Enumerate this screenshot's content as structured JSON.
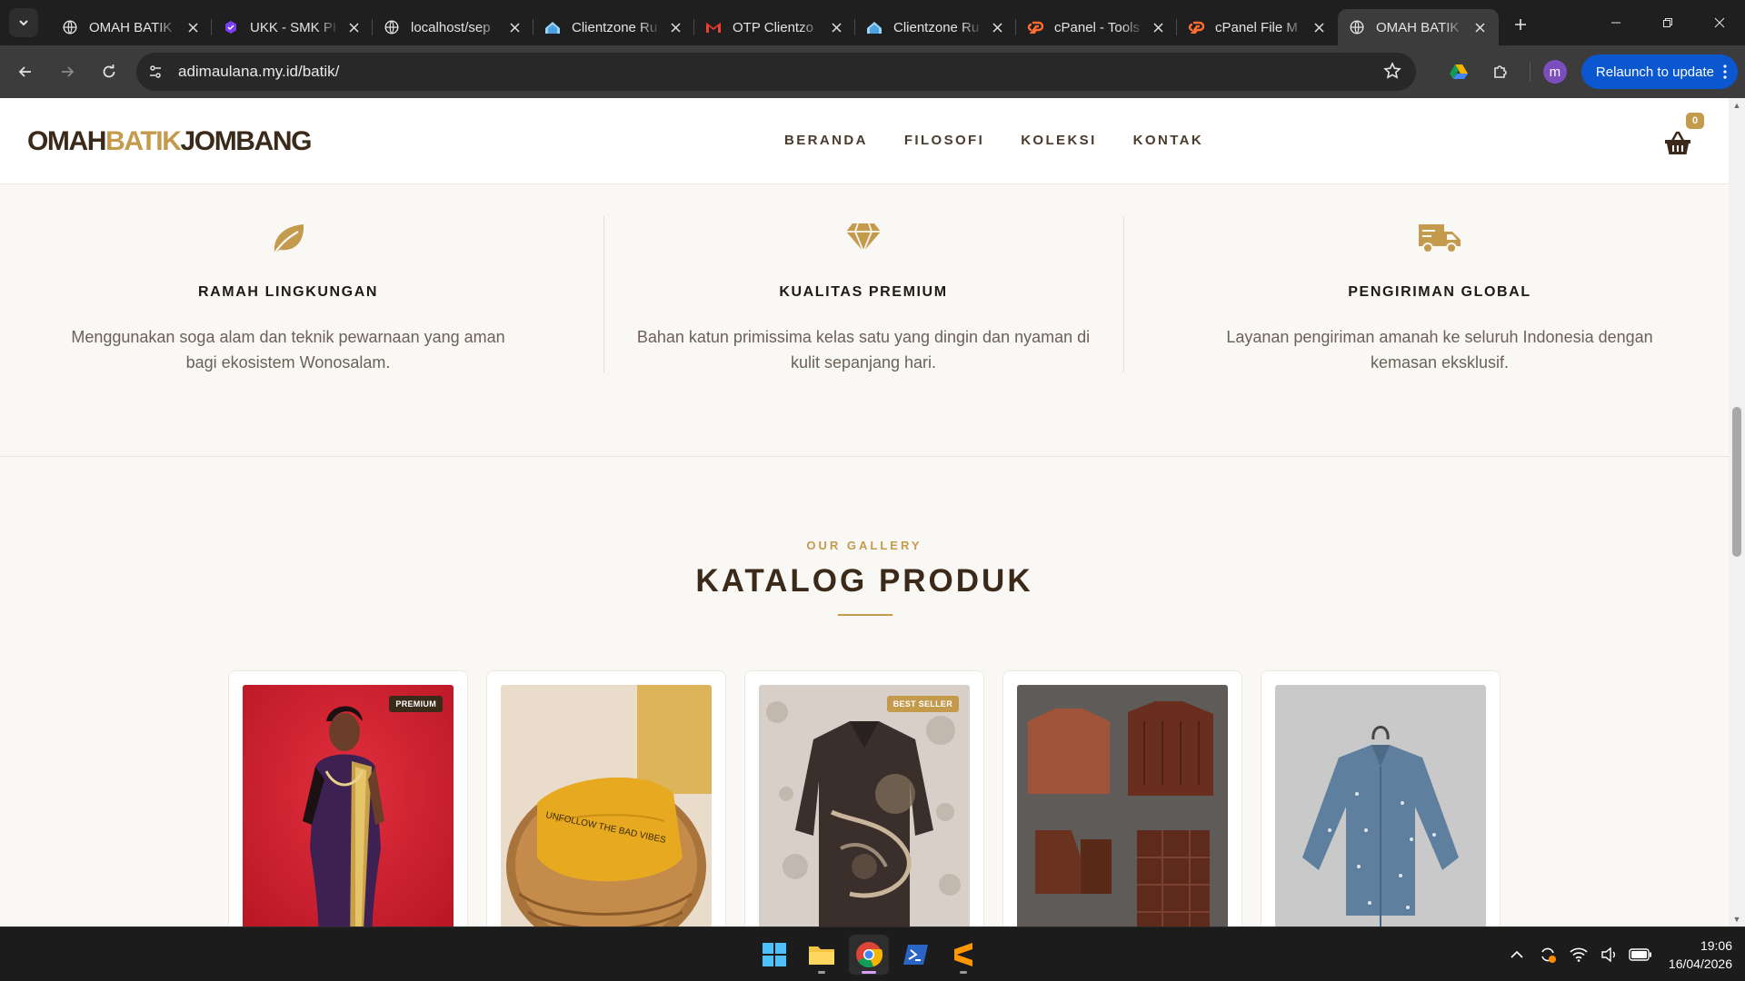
{
  "browser": {
    "tabs": [
      {
        "title": "OMAH BATIK",
        "icon": "globe-icon",
        "active": false
      },
      {
        "title": "UKK - SMK PI",
        "icon": "hexagon-icon",
        "active": false
      },
      {
        "title": "localhost/sep",
        "icon": "globe-icon",
        "active": false
      },
      {
        "title": "Clientzone Ru",
        "icon": "clientzone-icon",
        "active": false
      },
      {
        "title": "OTP Clientzo",
        "icon": "gmail-icon",
        "active": false
      },
      {
        "title": "Clientzone Ru",
        "icon": "clientzone-icon",
        "active": false
      },
      {
        "title": "cPanel - Tools",
        "icon": "cpanel-icon",
        "active": false
      },
      {
        "title": "cPanel File M",
        "icon": "cpanel-icon",
        "active": false
      },
      {
        "title": "OMAH BATIK",
        "icon": "globe-icon",
        "active": true
      }
    ],
    "url": "adimaulana.my.id/batik/",
    "profile_initial": "m",
    "relaunch_label": "Relaunch to update"
  },
  "site": {
    "logo": {
      "part1": "OMAH",
      "part2": "BATIK",
      "part3": "JOMBANG"
    },
    "nav": [
      "BERANDA",
      "FILOSOFI",
      "KOLEKSI",
      "KONTAK"
    ],
    "cart_count": "0",
    "features": [
      {
        "icon": "leaf-icon",
        "title": "RAMAH LINGKUNGAN",
        "text": "Menggunakan soga alam dan teknik pewarnaan yang aman bagi ekosistem Wonosalam."
      },
      {
        "icon": "gem-icon",
        "title": "KUALITAS PREMIUM",
        "text": "Bahan katun primissima kelas satu yang dingin dan nyaman di kulit sepanjang hari."
      },
      {
        "icon": "truck-icon",
        "title": "PENGIRIMAN GLOBAL",
        "text": "Layanan pengiriman amanah ke seluruh Indonesia dengan kemasan eksklusif."
      }
    ],
    "gallery": {
      "eyebrow": "OUR GALLERY",
      "title": "KATALOG PRODUK",
      "products": [
        {
          "badge": "PREMIUM",
          "image": "saree-photo"
        },
        {
          "badge": "",
          "image": "yellow-shirt-photo"
        },
        {
          "badge": "BEST SELLER",
          "image": "batik-shirt-photo"
        },
        {
          "badge": "",
          "image": "brown-clothes-photo"
        },
        {
          "badge": "",
          "image": "denim-shirt-photo"
        }
      ]
    }
  },
  "accent_color": "#c49a4d",
  "taskbar": {
    "time": "19:06",
    "date": "16/04/2026"
  }
}
